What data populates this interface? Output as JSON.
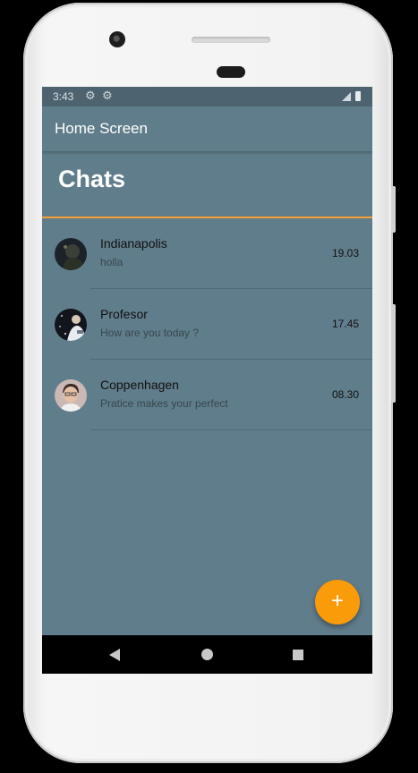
{
  "status_bar": {
    "time": "3:43",
    "icons": [
      "gear-icon",
      "gear-icon",
      "signal-icon",
      "battery-icon"
    ]
  },
  "app_bar": {
    "title": "Home Screen"
  },
  "page": {
    "heading": "Chats"
  },
  "chats": [
    {
      "name": "Indianapolis",
      "message": "holla",
      "time": "19.03"
    },
    {
      "name": "Profesor",
      "message": "How are you today ?",
      "time": "17.45"
    },
    {
      "name": "Coppenhagen",
      "message": "Pratice makes your perfect",
      "time": "08.30"
    }
  ],
  "fab": {
    "label": "+"
  },
  "nav_bar": {
    "icons": [
      "back-icon",
      "home-icon",
      "recents-icon"
    ]
  },
  "colors": {
    "primary": "#607d8b",
    "accent": "#fa9b0a",
    "divider_accent": "#f5a038"
  }
}
